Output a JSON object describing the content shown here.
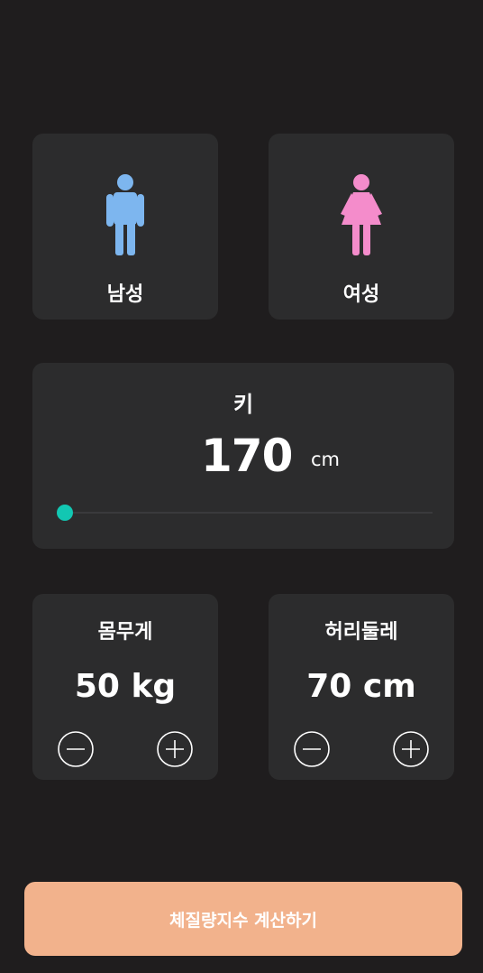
{
  "gender": {
    "male": {
      "label": "남성",
      "icon": "male-person-icon",
      "color": "#7db6ef"
    },
    "female": {
      "label": "여성",
      "icon": "female-person-icon",
      "color": "#f48ccb"
    }
  },
  "height": {
    "label": "키",
    "value": "170",
    "unit": "cm",
    "slider_fraction": 0.0,
    "accent": "#12c7b2"
  },
  "weight": {
    "label": "몸무게",
    "value": "50 kg",
    "minus_icon": "minus-circle-icon",
    "plus_icon": "plus-circle-icon"
  },
  "waist": {
    "label": "허리둘레",
    "value": "70 cm",
    "minus_icon": "minus-circle-icon",
    "plus_icon": "plus-circle-icon"
  },
  "action": {
    "label": "체질량지수 계산하기",
    "color": "#f2b28c"
  }
}
